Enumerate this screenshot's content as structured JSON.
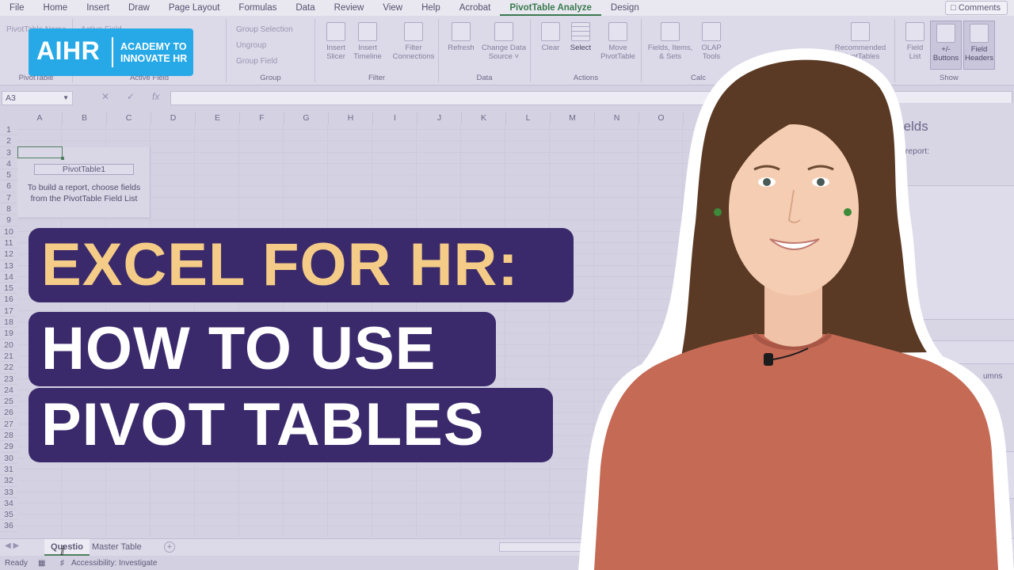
{
  "menubar": {
    "tabs": [
      "File",
      "Home",
      "Insert",
      "Draw",
      "Page Layout",
      "Formulas",
      "Data",
      "Review",
      "View",
      "Help",
      "Acrobat",
      "PivotTable Analyze",
      "Design"
    ],
    "active_tab": "PivotTable Analyze",
    "comments_label": "Comments"
  },
  "ribbon": {
    "pivottable_name_label": "PivotTable Name",
    "active_field_label": "Active Field",
    "group_selection": "Group Selection",
    "ungroup": "Ungroup",
    "group_field": "Group Field",
    "insert_slicer": [
      "Insert",
      "Slicer"
    ],
    "insert_timeline": [
      "Insert",
      "Timeline"
    ],
    "filter_connections": [
      "Filter",
      "Connections"
    ],
    "refresh": "Refresh",
    "change_data_source": [
      "Change Data",
      "Source"
    ],
    "clear": "Clear",
    "select": "Select",
    "move_pivottable": [
      "Move",
      "PivotTable"
    ],
    "fields_items_sets": [
      "Fields, Items,",
      "& Sets"
    ],
    "olap_tools": [
      "OLAP",
      "Tools"
    ],
    "recommended_pivottables": [
      "Recommended",
      "PivotTables"
    ],
    "field_list": [
      "Field",
      "List"
    ],
    "plus_minus_buttons": [
      "+/-",
      "Buttons"
    ],
    "field_headers": [
      "Field",
      "Headers"
    ],
    "group_labels": {
      "pivottable": "PivotTable",
      "active_field": "Active Field",
      "group": "Group",
      "filter": "Filter",
      "data": "Data",
      "actions": "Actions",
      "calculations": "Calc",
      "show": "Show"
    }
  },
  "formula_bar": {
    "name_box": "A3",
    "fx": "fx"
  },
  "sheet": {
    "columns": [
      "A",
      "B",
      "C",
      "D",
      "E",
      "F",
      "G",
      "H",
      "I",
      "J",
      "K",
      "L",
      "M",
      "N",
      "O"
    ],
    "rows": [
      "1",
      "2",
      "3",
      "4",
      "5",
      "6",
      "7",
      "8",
      "9",
      "10",
      "11",
      "12",
      "13",
      "14",
      "15",
      "16",
      "17",
      "18",
      "19",
      "20",
      "21",
      "22",
      "23",
      "24",
      "25",
      "26",
      "27",
      "28",
      "29",
      "30",
      "31",
      "32",
      "33",
      "34",
      "35",
      "36"
    ],
    "pivot_name": "PivotTable1",
    "pivot_hint_line1": "To build a report, choose fields",
    "pivot_hint_line2": "from the PivotTable Field List"
  },
  "field_pane": {
    "title": "ble Fields",
    "subtitle": "to add to report:",
    "columns_label": "umns"
  },
  "sheet_tabs": {
    "tabs": [
      "Questio",
      "Master Table"
    ],
    "active": "Questio",
    "add": "+"
  },
  "status_bar": {
    "ready": "Ready",
    "accessibility": "Accessibility: Investigate"
  },
  "logo": {
    "mark": "AIHR",
    "line1": "ACADEMY TO",
    "line2": "INNOVATE HR",
    "color": "#26a9e6"
  },
  "title": {
    "line1": "EXCEL FOR HR:",
    "line2": "HOW TO USE",
    "line3": "PIVOT TABLES",
    "band_color": "#3b2a6b",
    "line1_color": "#f5cc87",
    "line2_color": "#ffffff"
  }
}
